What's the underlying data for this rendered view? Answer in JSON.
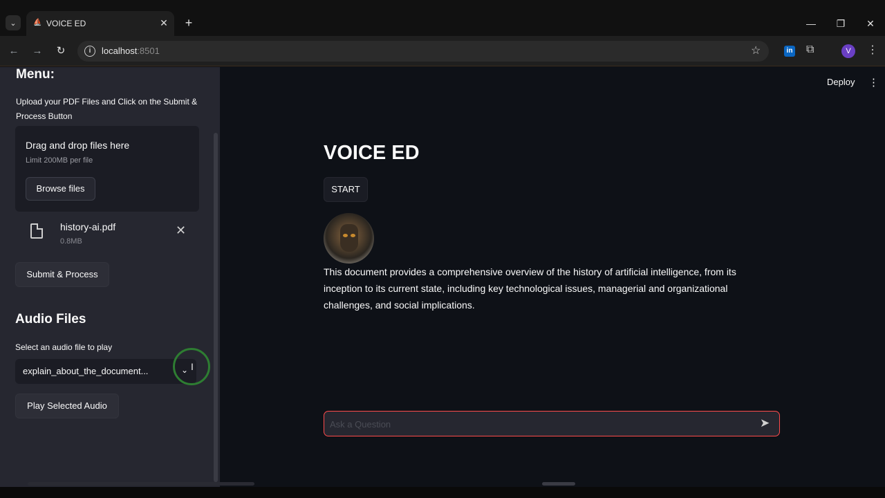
{
  "browser": {
    "tab_title": "VOICE ED",
    "url_host": "localhost",
    "url_port": ":8501",
    "profile_initial": "V",
    "ext_linkedin": "in"
  },
  "sidebar": {
    "heading": "Menu:",
    "description": "Upload your PDF Files and Click on the Submit & Process Button",
    "uploader": {
      "title": "Drag and drop files here",
      "limit": "Limit 200MB per file",
      "browse_label": "Browse files"
    },
    "file": {
      "name": "history-ai.pdf",
      "size": "0.8MB"
    },
    "submit_label": "Submit & Process",
    "audio_heading": "Audio Files",
    "select_label": "Select an audio file to play",
    "selected_audio": "explain_about_the_document...",
    "play_label": "Play Selected Audio"
  },
  "main": {
    "deploy_label": "Deploy",
    "title": "VOICE ED",
    "start_label": "START",
    "summary": "This document provides a comprehensive overview of the history of artificial intelligence, from its inception to its current state, including key technological issues, managerial and organizational challenges, and social implications.",
    "input_placeholder": "Ask a Question"
  },
  "colors": {
    "accent": "#ff4b4b",
    "background": "#0e1117",
    "sidebar": "#262730"
  }
}
